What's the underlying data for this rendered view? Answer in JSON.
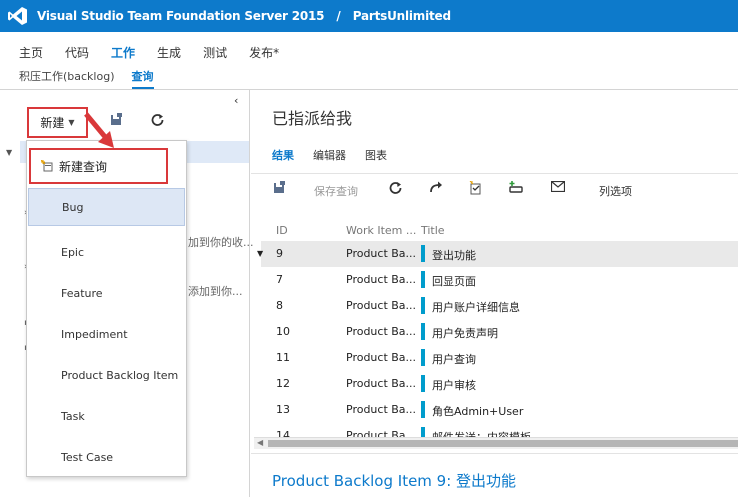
{
  "app": {
    "server": "Visual Studio Team Foundation Server 2015",
    "separator": "/",
    "project": "PartsUnlimited"
  },
  "nav": {
    "hubs": [
      "主页",
      "代码",
      "工作",
      "生成",
      "测试",
      "发布*"
    ],
    "active_hub": "工作",
    "subtabs": [
      "积压工作(backlog)",
      "查询"
    ],
    "active_subtab": "查询"
  },
  "left": {
    "new_button": "新建",
    "fragments": [
      "加到你的收...",
      "添加到你..."
    ]
  },
  "menu": {
    "new_query": "新建查询",
    "items": [
      "Bug",
      "Epic",
      "Feature",
      "Impediment",
      "Product Backlog Item",
      "Task",
      "Test Case"
    ],
    "highlighted": "Bug"
  },
  "right": {
    "title": "已指派给我",
    "tabs": [
      "结果",
      "编辑器",
      "图表"
    ],
    "active_tab": "结果",
    "toolbar": {
      "save_query": "保存查询",
      "column_options": "列选项"
    },
    "columns": [
      "ID",
      "Work Item ...",
      "Title"
    ],
    "rows": [
      {
        "id": "9",
        "type": "Product Ba...",
        "title": "登出功能"
      },
      {
        "id": "7",
        "type": "Product Ba...",
        "title": "回显页面"
      },
      {
        "id": "8",
        "type": "Product Ba...",
        "title": "用户账户详细信息"
      },
      {
        "id": "10",
        "type": "Product Ba...",
        "title": "用户免责声明"
      },
      {
        "id": "11",
        "type": "Product Ba...",
        "title": "用户查询"
      },
      {
        "id": "12",
        "type": "Product Ba...",
        "title": "用户审核"
      },
      {
        "id": "13",
        "type": "Product Ba...",
        "title": "角色Admin+User"
      },
      {
        "id": "14",
        "type": "Product Ba...",
        "title": "邮件发送：内容模板"
      }
    ],
    "selected_row_id": "9",
    "detail_title": "Product Backlog Item 9: 登出功能"
  },
  "colors": {
    "brand_blue": "#0d7acb",
    "highlight_red": "#d9383a",
    "pbi_bar": "#009ccc"
  },
  "icons": [
    "visual-studio-logo",
    "save-icon",
    "refresh-icon",
    "redo-icon",
    "query-icon",
    "link-icon",
    "mail-icon",
    "new-query-icon",
    "collapse-chevron-icon"
  ]
}
